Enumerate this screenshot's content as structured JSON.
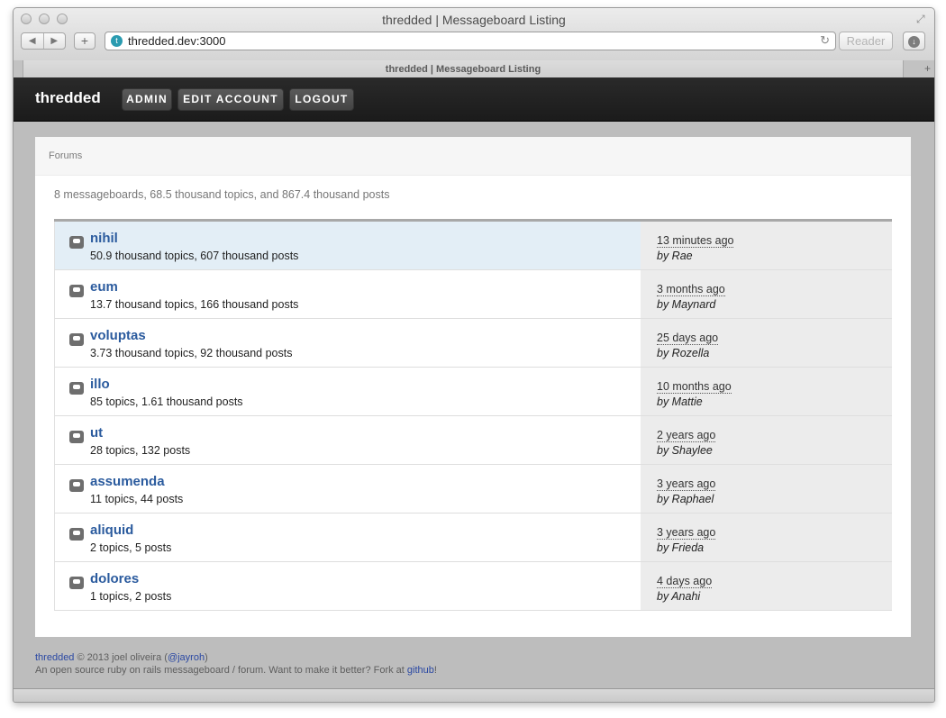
{
  "window": {
    "title": "thredded | Messageboard Listing",
    "url": "thredded.dev:3000",
    "reader_label": "Reader",
    "tab_title": "thredded | Messageboard Listing"
  },
  "nav": {
    "brand": "thredded",
    "links": [
      "ADMIN",
      "EDIT ACCOUNT",
      "LOGOUT"
    ]
  },
  "breadcrumb": "Forums",
  "summary": "8 messageboards, 68.5 thousand topics, and 867.4 thousand posts",
  "boards": [
    {
      "name": "nihil",
      "stats": "50.9 thousand topics, 607 thousand posts",
      "time": "13 minutes ago",
      "by": "by Rae"
    },
    {
      "name": "eum",
      "stats": "13.7 thousand topics, 166 thousand posts",
      "time": "3 months ago",
      "by": "by Maynard"
    },
    {
      "name": "voluptas",
      "stats": "3.73 thousand topics, 92 thousand posts",
      "time": "25 days ago",
      "by": "by Rozella"
    },
    {
      "name": "illo",
      "stats": "85 topics, 1.61 thousand posts",
      "time": "10 months ago",
      "by": "by Mattie"
    },
    {
      "name": "ut",
      "stats": "28 topics, 132 posts",
      "time": "2 years ago",
      "by": "by Shaylee"
    },
    {
      "name": "assumenda",
      "stats": "11 topics, 44 posts",
      "time": "3 years ago",
      "by": "by Raphael"
    },
    {
      "name": "aliquid",
      "stats": "2 topics, 5 posts",
      "time": "3 years ago",
      "by": "by Frieda"
    },
    {
      "name": "dolores",
      "stats": "1 topics, 2 posts",
      "time": "4 days ago",
      "by": "by Anahi"
    }
  ],
  "footer": {
    "brand_link": "thredded",
    "copyright": " © 2013 joel oliveira (",
    "handle_link": "@jayroh",
    "paren_close": ")",
    "line2": "An open source ruby on rails messageboard / forum. Want to make it better? Fork at ",
    "github_link": "github",
    "exclaim": "!"
  },
  "colors": {
    "link": "#2b5b9e",
    "active_row": "#e3eef6",
    "navbar": "#1b1b1b"
  },
  "icons": [
    "back-arrow-icon",
    "forward-arrow-icon",
    "add-bookmark-icon",
    "favicon-icon",
    "reload-icon",
    "downloads-icon",
    "fullscreen-icon",
    "new-tab-icon",
    "messageboard-icon"
  ]
}
